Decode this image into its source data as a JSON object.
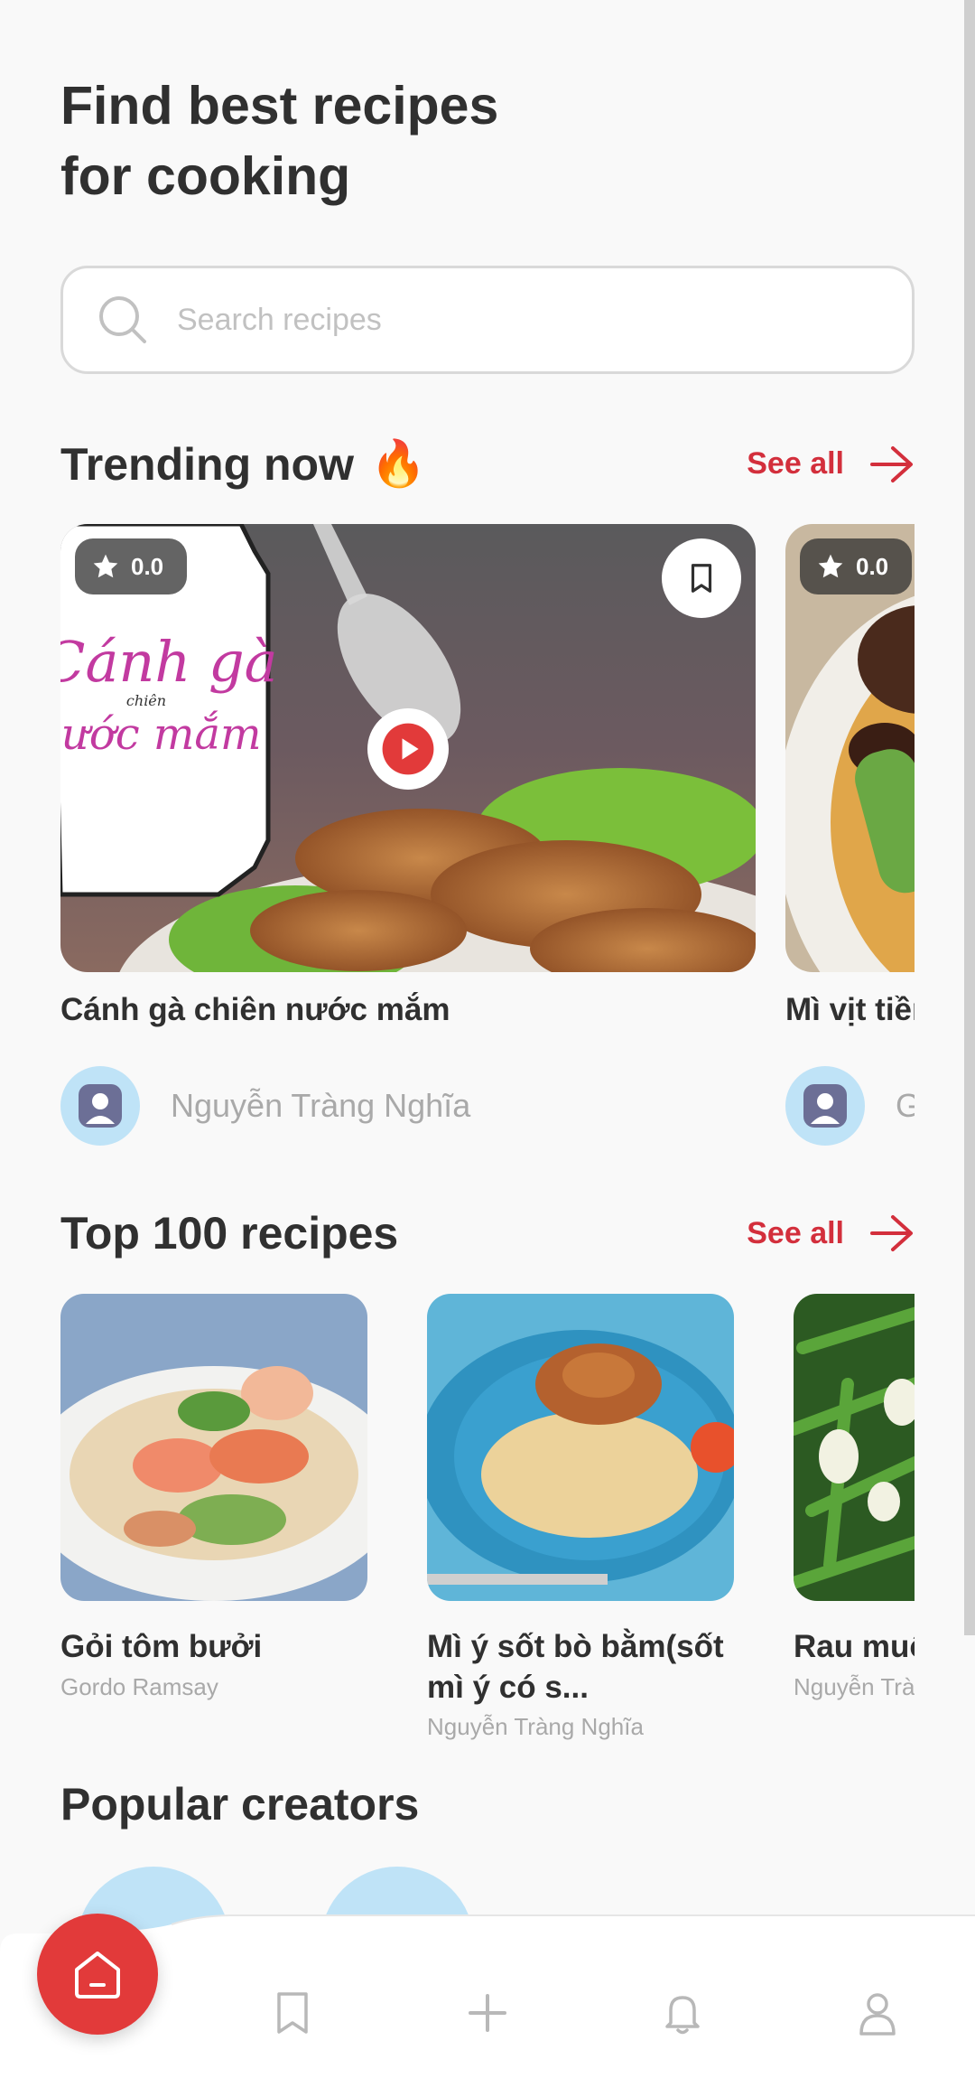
{
  "header": {
    "title_line1": "Find best recipes",
    "title_line2": "for cooking"
  },
  "search": {
    "placeholder": "Search recipes"
  },
  "trending": {
    "title": "Trending now",
    "emoji": "🔥",
    "see_all": "See all",
    "cards": [
      {
        "rating": "0.0",
        "title": "Cánh gà chiên nước mắm",
        "author": "Nguyễn Tràng Nghĩa",
        "overlay_text_1": "Cánh gà",
        "overlay_text_small": "chiên",
        "overlay_text_2": "nước mắm"
      },
      {
        "rating": "0.0",
        "title": "Mì vịt tiềm",
        "author": "Gordo Ramsay"
      }
    ]
  },
  "top100": {
    "title": "Top 100 recipes",
    "see_all": "See all",
    "items": [
      {
        "title": "Gỏi tôm bưởi",
        "author": "Gordo Ramsay"
      },
      {
        "title": "Mì ý sốt bò bằm(sốt mì ý có s...",
        "author": "Nguyễn Tràng Nghĩa"
      },
      {
        "title": "Rau muống",
        "author": "Nguyễn Tràng Nghĩa"
      }
    ]
  },
  "creators": {
    "title": "Popular creators"
  },
  "nav": {
    "items": [
      "home-icon",
      "bookmark-icon",
      "plus-icon",
      "bell-icon",
      "profile-icon"
    ]
  },
  "colors": {
    "accent": "#e23a3a",
    "see_all": "#d32f3c",
    "text": "#303030",
    "muted": "#a9a9a9"
  }
}
